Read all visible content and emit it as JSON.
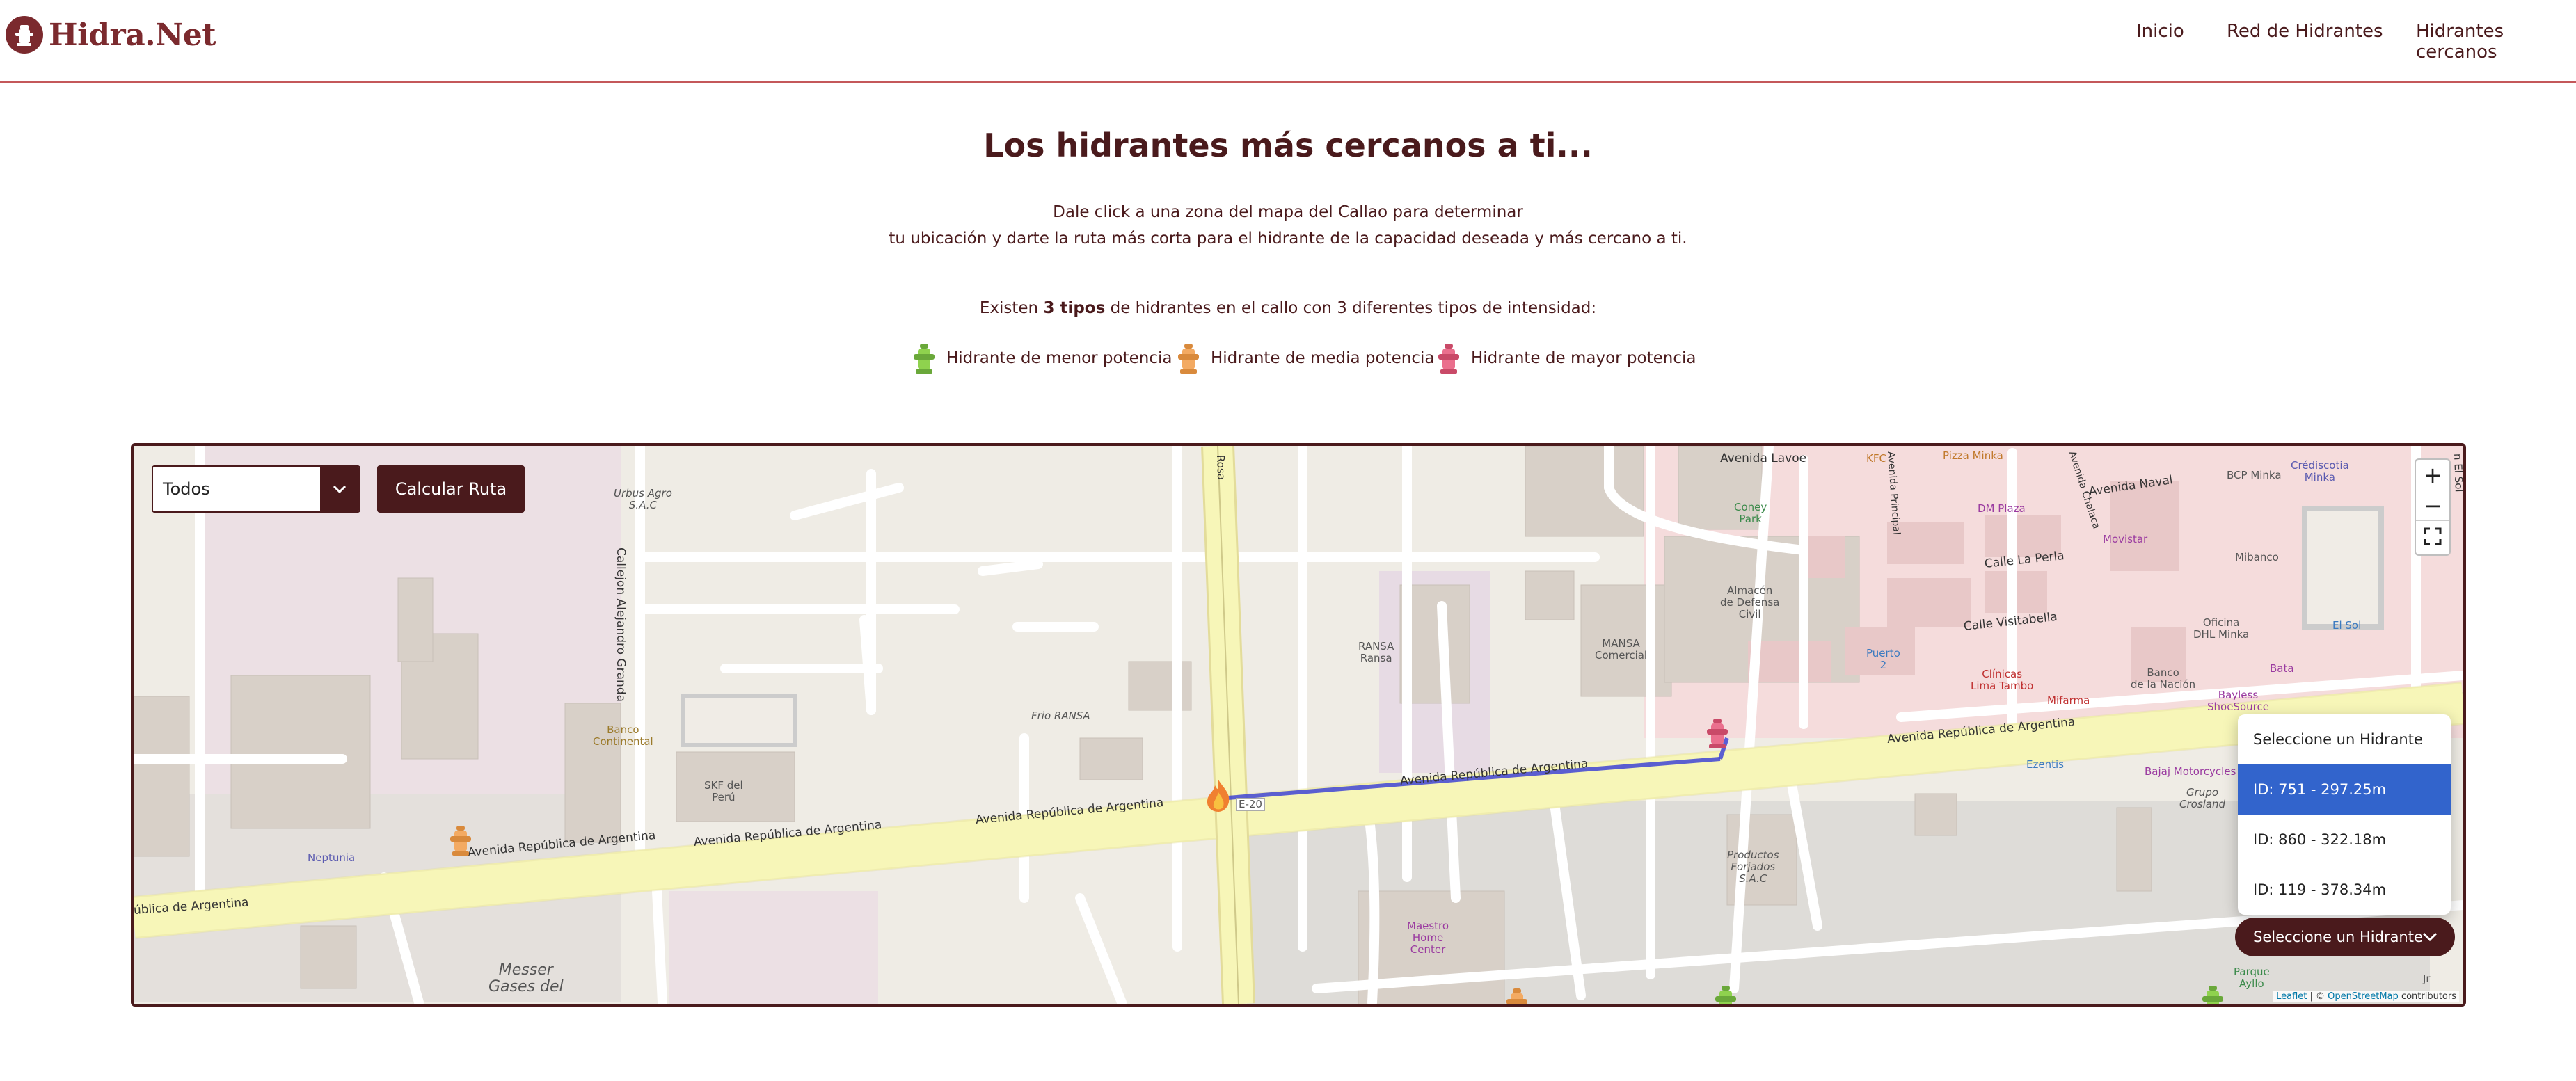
{
  "header": {
    "logo_text": "Hidra.Net",
    "nav": [
      "Inicio",
      "Red de Hidrantes",
      "Hidrantes cercanos"
    ]
  },
  "main": {
    "title": "Los hidrantes más cercanos a ti...",
    "description_line1": "Dale click a una zona del mapa del Callao para determinar",
    "description_line2": "tu ubicación y darte la ruta más corta para el hidrante de la capacidad deseada y más cercano a ti.",
    "types_prefix": "Existen",
    "types_bold": "3 tipos",
    "types_suffix": "de hidrantes en el callo con 3 diferentes tipos de intensidad:",
    "legend": [
      {
        "label": "Hidrante de menor potencia",
        "icon": "hydrant-green-icon",
        "color": "#7cc342"
      },
      {
        "label": "Hidrante de media potencia",
        "icon": "hydrant-orange-icon",
        "color": "#f0a050"
      },
      {
        "label": "Hidrante de mayor potencia",
        "icon": "hydrant-pink-icon",
        "color": "#e0607e"
      }
    ]
  },
  "map": {
    "select_value": "Todos",
    "calc_button": "Calcular Ruta",
    "zoom_in": "+",
    "zoom_out": "−",
    "hydrant_dropdown": {
      "toggle_label": "Seleccione un Hidrante",
      "options": [
        "Seleccione un Hidrante",
        "ID: 751 - 297.25m",
        "ID: 860 - 322.18m",
        "ID: 119 - 378.34m"
      ],
      "active_index": 1
    },
    "attribution": {
      "leaflet": "Leaflet",
      "sep": " | © ",
      "osm": "OpenStreetMap",
      "suffix": " contributors"
    },
    "labels": {
      "avenida": "Avenida República de Argentina",
      "avenida_short": "ública de Argentina",
      "avenida_lavoe": "Avenida Lavoe",
      "avenida_naval": "Avenida Naval",
      "calle_la_perla": "Calle La Perla",
      "calle_visitabella": "Calle Visitabella",
      "callejon": "Callejon Alejandro Granda",
      "avenida_principal": "Avenida Principal",
      "avenida_chalaca": "Avenida Chalaca",
      "rosa": "Rosa",
      "el_sol_road": "n El Sol",
      "urbus": "Urbus Agro\nS.A.C",
      "banco_continental": "Banco\nContinental",
      "skf": "SKF del\nPerú",
      "frio_ransa": "Frio RANSA",
      "ransa": "RANSA\nRansa",
      "mansa": "MANSA\nComercial",
      "almacen": "Almacén\nde Defensa\nCivil",
      "coney": "Coney\nPark",
      "kfc": "KFC",
      "pizza": "Pizza Minka",
      "dm_plaza": "DM Plaza",
      "movistar": "Movistar",
      "bcp": "BCP Minka",
      "scotia": "Crédiscotia\nMinka",
      "mibanco": "Mibanco",
      "oficina": "Oficina\nDHL Minka",
      "el_sol": "El Sol",
      "puerto": "Puerto\n2",
      "clinicas": "Clínicas\nLima Tambo",
      "mifarma": "Mifarma",
      "banco_nacion": "Banco\nde la Nación",
      "bata": "Bata",
      "bayless": "Bayless\nShoeSource",
      "ezentis": "Ezentis",
      "bajaj": "Bajaj Motorcycles",
      "grupo": "Grupo\nCrosland",
      "productos": "Productos\nForjados\nS.A.C",
      "maestro": "Maestro\nHome\nCenter",
      "neptunia": "Neptunia",
      "messer": "Messer\nGases del",
      "e20": "E-20",
      "parque": "Parque\nAyllo",
      "jr": "Jr"
    }
  }
}
